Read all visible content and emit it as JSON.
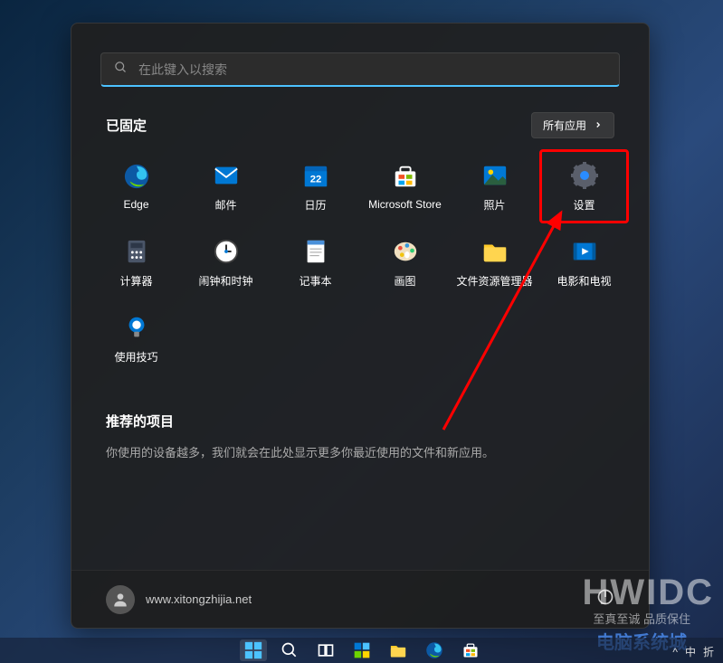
{
  "search": {
    "placeholder": "在此键入以搜索"
  },
  "sections": {
    "pinned_title": "已固定",
    "all_apps_label": "所有应用",
    "recommended_title": "推荐的项目",
    "recommended_text": "你使用的设备越多，我们就会在此处显示更多你最近使用的文件和新应用。"
  },
  "pinned_apps": [
    {
      "label": "Edge",
      "icon": "edge"
    },
    {
      "label": "邮件",
      "icon": "mail"
    },
    {
      "label": "日历",
      "icon": "calendar"
    },
    {
      "label": "Microsoft Store",
      "icon": "store"
    },
    {
      "label": "照片",
      "icon": "photos"
    },
    {
      "label": "设置",
      "icon": "settings",
      "highlighted": true
    },
    {
      "label": "计算器",
      "icon": "calculator"
    },
    {
      "label": "闹钟和时钟",
      "icon": "clock"
    },
    {
      "label": "记事本",
      "icon": "notepad"
    },
    {
      "label": "画图",
      "icon": "paint"
    },
    {
      "label": "文件资源管理器",
      "icon": "explorer"
    },
    {
      "label": "电影和电视",
      "icon": "movies"
    },
    {
      "label": "使用技巧",
      "icon": "tips"
    }
  ],
  "footer": {
    "username": "www.xitongzhijia.net"
  },
  "taskbar": {
    "items": [
      "start",
      "search",
      "taskview",
      "widgets",
      "explorer",
      "edge",
      "store"
    ]
  },
  "tray": {
    "items": [
      "^",
      "中",
      "折"
    ]
  },
  "watermark": {
    "main": "HWIDC",
    "sub1": "至真至诚  品质保住",
    "sub2": "电脑系统城"
  },
  "colors": {
    "highlight_border": "#ff0000",
    "search_accent": "#4cc2ff"
  }
}
